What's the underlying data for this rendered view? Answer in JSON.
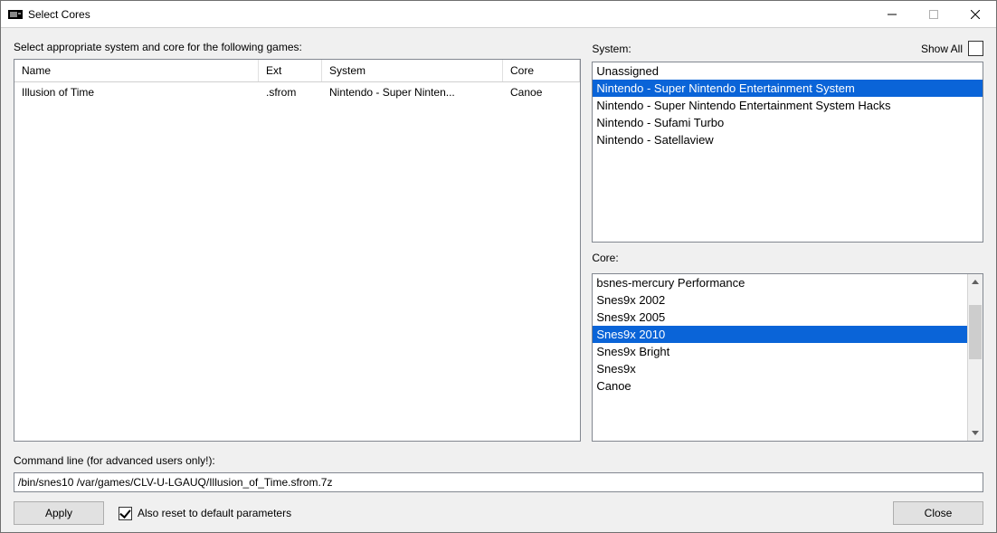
{
  "window": {
    "title": "Select Cores"
  },
  "instruction": "Select appropriate system and core for the following games:",
  "games": {
    "columns": {
      "name": "Name",
      "ext": "Ext",
      "system": "System",
      "core": "Core"
    },
    "rows": [
      {
        "name": "Illusion of Time",
        "ext": ".sfrom",
        "system": "Nintendo - Super Ninten...",
        "core": "Canoe"
      }
    ]
  },
  "system": {
    "label": "System:",
    "show_all_label": "Show All",
    "items": [
      {
        "label": "Unassigned",
        "selected": false
      },
      {
        "label": "Nintendo - Super Nintendo Entertainment System",
        "selected": true
      },
      {
        "label": "Nintendo - Super Nintendo Entertainment System Hacks",
        "selected": false
      },
      {
        "label": "Nintendo - Sufami Turbo",
        "selected": false
      },
      {
        "label": "Nintendo - Satellaview",
        "selected": false
      }
    ]
  },
  "core": {
    "label": "Core:",
    "items": [
      {
        "label": "bsnes-mercury Performance",
        "selected": false
      },
      {
        "label": "Snes9x 2002",
        "selected": false
      },
      {
        "label": "Snes9x 2005",
        "selected": false
      },
      {
        "label": "Snes9x 2010",
        "selected": true
      },
      {
        "label": "Snes9x Bright",
        "selected": false
      },
      {
        "label": "Snes9x",
        "selected": false
      },
      {
        "label": "Canoe",
        "selected": false
      }
    ]
  },
  "cmdline": {
    "label": "Command line (for advanced users only!):",
    "value": "/bin/snes10 /var/games/CLV-U-LGAUQ/Illusion_of_Time.sfrom.7z"
  },
  "buttons": {
    "apply": "Apply",
    "close": "Close"
  },
  "reset_checkbox": {
    "label": "Also reset to default parameters",
    "checked": true
  }
}
